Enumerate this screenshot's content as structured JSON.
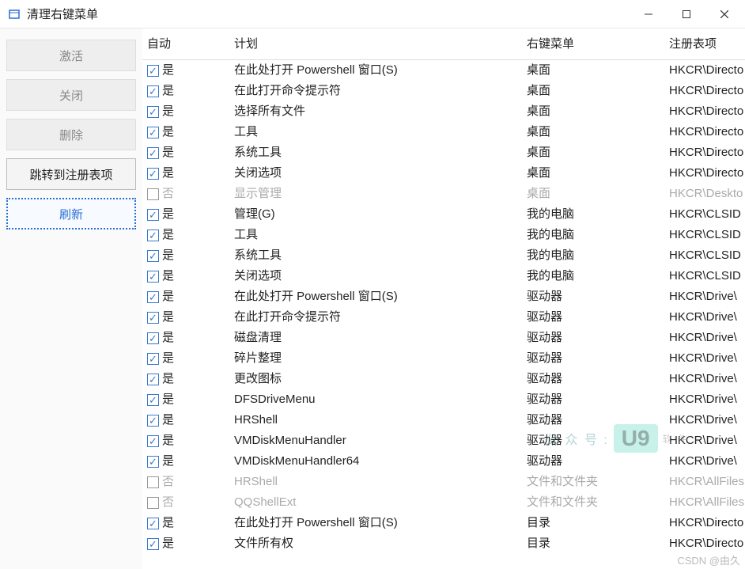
{
  "window": {
    "title": "清理右键菜单"
  },
  "sidebar": {
    "buttons": [
      {
        "label": "激活",
        "state": "disabled"
      },
      {
        "label": "关闭",
        "state": "disabled"
      },
      {
        "label": "删除",
        "state": "disabled"
      },
      {
        "label": "跳转到注册表项",
        "state": "enabled"
      },
      {
        "label": "刷新",
        "state": "active"
      }
    ]
  },
  "table": {
    "headers": {
      "auto": "自动",
      "plan": "计划",
      "menu": "右键菜单",
      "reg": "注册表项"
    },
    "yes": "是",
    "no": "否",
    "rows": [
      {
        "checked": true,
        "auto": "是",
        "plan": "在此处打开 Powershell 窗口(S)",
        "menu": "桌面",
        "reg": "HKCR\\Directo"
      },
      {
        "checked": true,
        "auto": "是",
        "plan": "在此打开命令提示符",
        "menu": "桌面",
        "reg": "HKCR\\Directo"
      },
      {
        "checked": true,
        "auto": "是",
        "plan": "选择所有文件",
        "menu": "桌面",
        "reg": "HKCR\\Directo"
      },
      {
        "checked": true,
        "auto": "是",
        "plan": "工具",
        "menu": "桌面",
        "reg": "HKCR\\Directo"
      },
      {
        "checked": true,
        "auto": "是",
        "plan": "系统工具",
        "menu": "桌面",
        "reg": "HKCR\\Directo"
      },
      {
        "checked": true,
        "auto": "是",
        "plan": "关闭选项",
        "menu": "桌面",
        "reg": "HKCR\\Directo"
      },
      {
        "checked": false,
        "auto": "否",
        "plan": "显示管理",
        "menu": "桌面",
        "reg": "HKCR\\Deskto"
      },
      {
        "checked": true,
        "auto": "是",
        "plan": "管理(G)",
        "menu": "我的电脑",
        "reg": "HKCR\\CLSID"
      },
      {
        "checked": true,
        "auto": "是",
        "plan": "工具",
        "menu": "我的电脑",
        "reg": "HKCR\\CLSID"
      },
      {
        "checked": true,
        "auto": "是",
        "plan": "系统工具",
        "menu": "我的电脑",
        "reg": "HKCR\\CLSID"
      },
      {
        "checked": true,
        "auto": "是",
        "plan": "关闭选项",
        "menu": "我的电脑",
        "reg": "HKCR\\CLSID"
      },
      {
        "checked": true,
        "auto": "是",
        "plan": "在此处打开 Powershell 窗口(S)",
        "menu": "驱动器",
        "reg": "HKCR\\Drive\\"
      },
      {
        "checked": true,
        "auto": "是",
        "plan": "在此打开命令提示符",
        "menu": "驱动器",
        "reg": "HKCR\\Drive\\"
      },
      {
        "checked": true,
        "auto": "是",
        "plan": "磁盘清理",
        "menu": "驱动器",
        "reg": "HKCR\\Drive\\"
      },
      {
        "checked": true,
        "auto": "是",
        "plan": "碎片整理",
        "menu": "驱动器",
        "reg": "HKCR\\Drive\\"
      },
      {
        "checked": true,
        "auto": "是",
        "plan": "更改图标",
        "menu": "驱动器",
        "reg": "HKCR\\Drive\\"
      },
      {
        "checked": true,
        "auto": "是",
        "plan": "DFSDriveMenu",
        "menu": "驱动器",
        "reg": "HKCR\\Drive\\"
      },
      {
        "checked": true,
        "auto": "是",
        "plan": "HRShell",
        "menu": "驱动器",
        "reg": "HKCR\\Drive\\"
      },
      {
        "checked": true,
        "auto": "是",
        "plan": "VMDiskMenuHandler",
        "menu": "驱动器",
        "reg": "HKCR\\Drive\\"
      },
      {
        "checked": true,
        "auto": "是",
        "plan": "VMDiskMenuHandler64",
        "menu": "驱动器",
        "reg": "HKCR\\Drive\\"
      },
      {
        "checked": false,
        "auto": "否",
        "plan": "HRShell",
        "menu": "文件和文件夹",
        "reg": "HKCR\\AllFiles"
      },
      {
        "checked": false,
        "auto": "否",
        "plan": "QQShellExt",
        "menu": "文件和文件夹",
        "reg": "HKCR\\AllFiles"
      },
      {
        "checked": true,
        "auto": "是",
        "plan": "在此处打开 Powershell 窗口(S)",
        "menu": "目录",
        "reg": "HKCR\\Directo"
      },
      {
        "checked": true,
        "auto": "是",
        "plan": "文件所有权",
        "menu": "目录",
        "reg": "HKCR\\Directo"
      }
    ]
  },
  "watermark": {
    "prefix": "公 众 号 :",
    "badge": "U9",
    "sub": "软 件"
  },
  "footer": "CSDN @由久"
}
